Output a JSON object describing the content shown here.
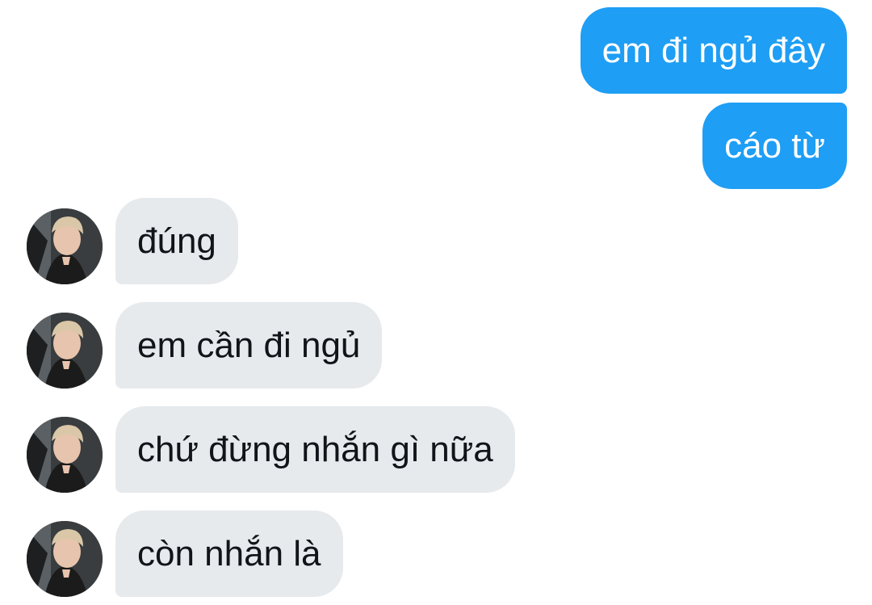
{
  "conversation": {
    "sent": [
      {
        "text": "em đi ngủ đây"
      },
      {
        "text": "cáo từ"
      }
    ],
    "received": [
      {
        "text": "đúng"
      },
      {
        "text": "em cần đi ngủ"
      },
      {
        "text": "chứ đừng nhắn gì nữa"
      },
      {
        "text": "còn nhắn là"
      }
    ]
  },
  "colors": {
    "sent_bubble": "#1e9ef4",
    "received_bubble": "#e6eaed",
    "sent_text": "#ffffff",
    "received_text": "#111418"
  },
  "icons": {
    "avatar": "contact-avatar"
  }
}
